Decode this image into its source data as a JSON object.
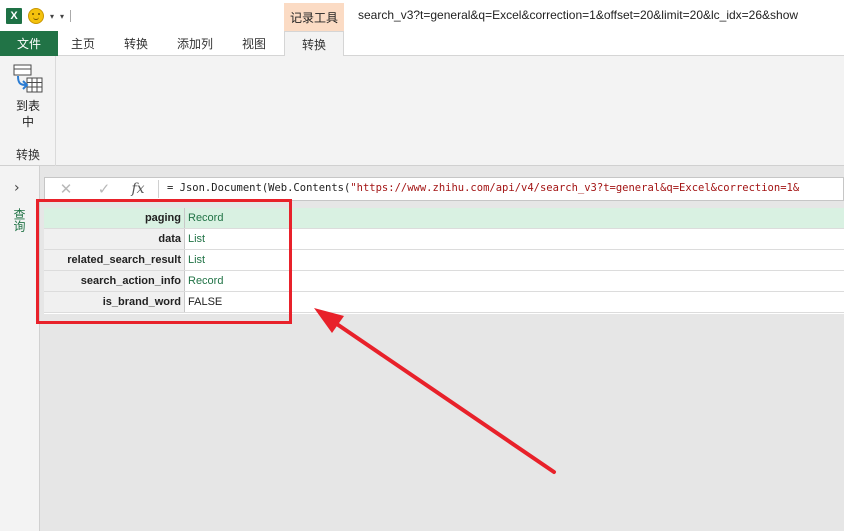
{
  "titlebar": {
    "app_icon": "excel-icon",
    "app_icon_letter": "X",
    "smiley_icon": "smiley-feedback-icon",
    "qat_dropdown": "▾",
    "context_tab_header": "记录工具",
    "window_title": "search_v3?t=general&q=Excel&correction=1&offset=20&limit=20&lc_idx=26&show"
  },
  "ribbon_tabs": {
    "file": "文件",
    "home": "主页",
    "transform": "转换",
    "add_column": "添加列",
    "view": "视图",
    "record_transform": "转换"
  },
  "ribbon": {
    "to_table_label": "到表中",
    "group_label": "转换"
  },
  "left_pane": {
    "expand_glyph": "›",
    "label": "查询"
  },
  "formula_bar": {
    "cancel_glyph": "✕",
    "confirm_glyph": "✓",
    "fx_label": "fx",
    "formula_prefix": "= Json.Document(Web.Contents(",
    "formula_string": "\"https://www.zhihu.com/api/v4/search_v3?t=general&q=Excel&correction=1&"
  },
  "record": {
    "rows": [
      {
        "key": "paging",
        "value": "Record"
      },
      {
        "key": "data",
        "value": "List"
      },
      {
        "key": "related_search_result",
        "value": "List"
      },
      {
        "key": "search_action_info",
        "value": "Record"
      },
      {
        "key": "is_brand_word",
        "value": "FALSE"
      }
    ]
  },
  "colors": {
    "excel_green": "#217346",
    "context_tab_bg": "#fbdbc4",
    "selection_row": "#d9f1e2",
    "annotation_red": "#e8212a"
  }
}
